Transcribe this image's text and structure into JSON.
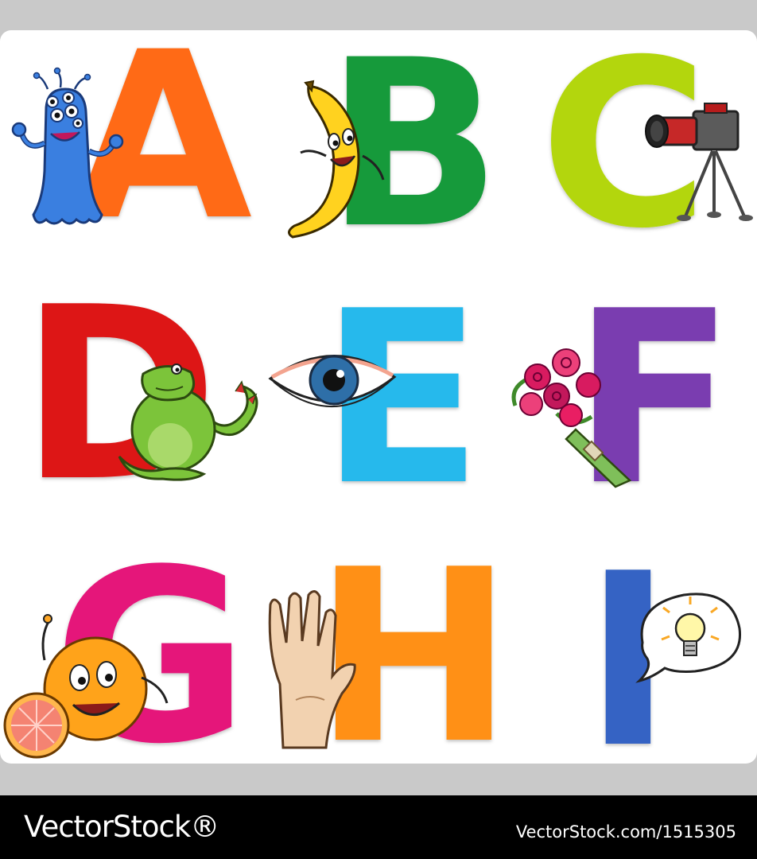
{
  "letters": [
    {
      "char": "A",
      "color": "#ff6a14",
      "character": "blue-monster"
    },
    {
      "char": "B",
      "color": "#169a3a",
      "character": "banana"
    },
    {
      "char": "C",
      "color": "#b3d60f",
      "character": "camera"
    },
    {
      "char": "D",
      "color": "#dd1616",
      "character": "dragon"
    },
    {
      "char": "E",
      "color": "#27b9ec",
      "character": "eye"
    },
    {
      "char": "F",
      "color": "#7a3db0",
      "character": "flowers"
    },
    {
      "char": "G",
      "color": "#e5157a",
      "character": "grapefruit"
    },
    {
      "char": "H",
      "color": "#ff9012",
      "character": "hand"
    },
    {
      "char": "I",
      "color": "#3563c4",
      "character": "idea-bulb"
    }
  ],
  "footer": {
    "brand": "VectorStock®",
    "stock_id": "VectorStock.com/1515305"
  }
}
